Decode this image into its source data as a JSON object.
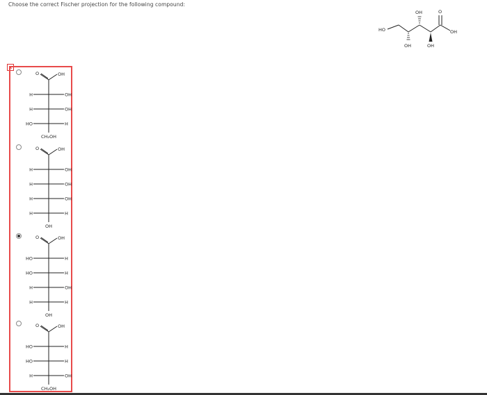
{
  "question": "Choose the correct Fischer projection for the following compound:",
  "mark": "x",
  "compound": {
    "labels": {
      "top_oh": "OH",
      "left_oh": "HO",
      "bottom_oh1": "OH",
      "bottom_oh2": "OH",
      "carbonyl_o": "O",
      "acid_oh": "OH"
    }
  },
  "options": [
    {
      "selected": false,
      "top": "OH",
      "carbonyl": "O",
      "rows": [
        {
          "left": "H",
          "right": "OH"
        },
        {
          "left": "H",
          "right": "OH"
        },
        {
          "left": "HO",
          "right": "H"
        }
      ],
      "bottom": "CH₂OH"
    },
    {
      "selected": false,
      "top": "OH",
      "carbonyl": "O",
      "rows": [
        {
          "left": "H",
          "right": "OH"
        },
        {
          "left": "H",
          "right": "OH"
        },
        {
          "left": "H",
          "right": "OH"
        },
        {
          "left": "H",
          "right": "H"
        }
      ],
      "bottom": "OH"
    },
    {
      "selected": true,
      "top": "OH",
      "carbonyl": "O",
      "rows": [
        {
          "left": "HO",
          "right": "H"
        },
        {
          "left": "HO",
          "right": "H"
        },
        {
          "left": "H",
          "right": "OH"
        },
        {
          "left": "H",
          "right": "H"
        }
      ],
      "bottom": "OH"
    },
    {
      "selected": false,
      "top": "OH",
      "carbonyl": "O",
      "rows": [
        {
          "left": "HO",
          "right": "H"
        },
        {
          "left": "HO",
          "right": "H"
        },
        {
          "left": "H",
          "right": "OH"
        }
      ],
      "bottom": "CH₂OH"
    }
  ]
}
